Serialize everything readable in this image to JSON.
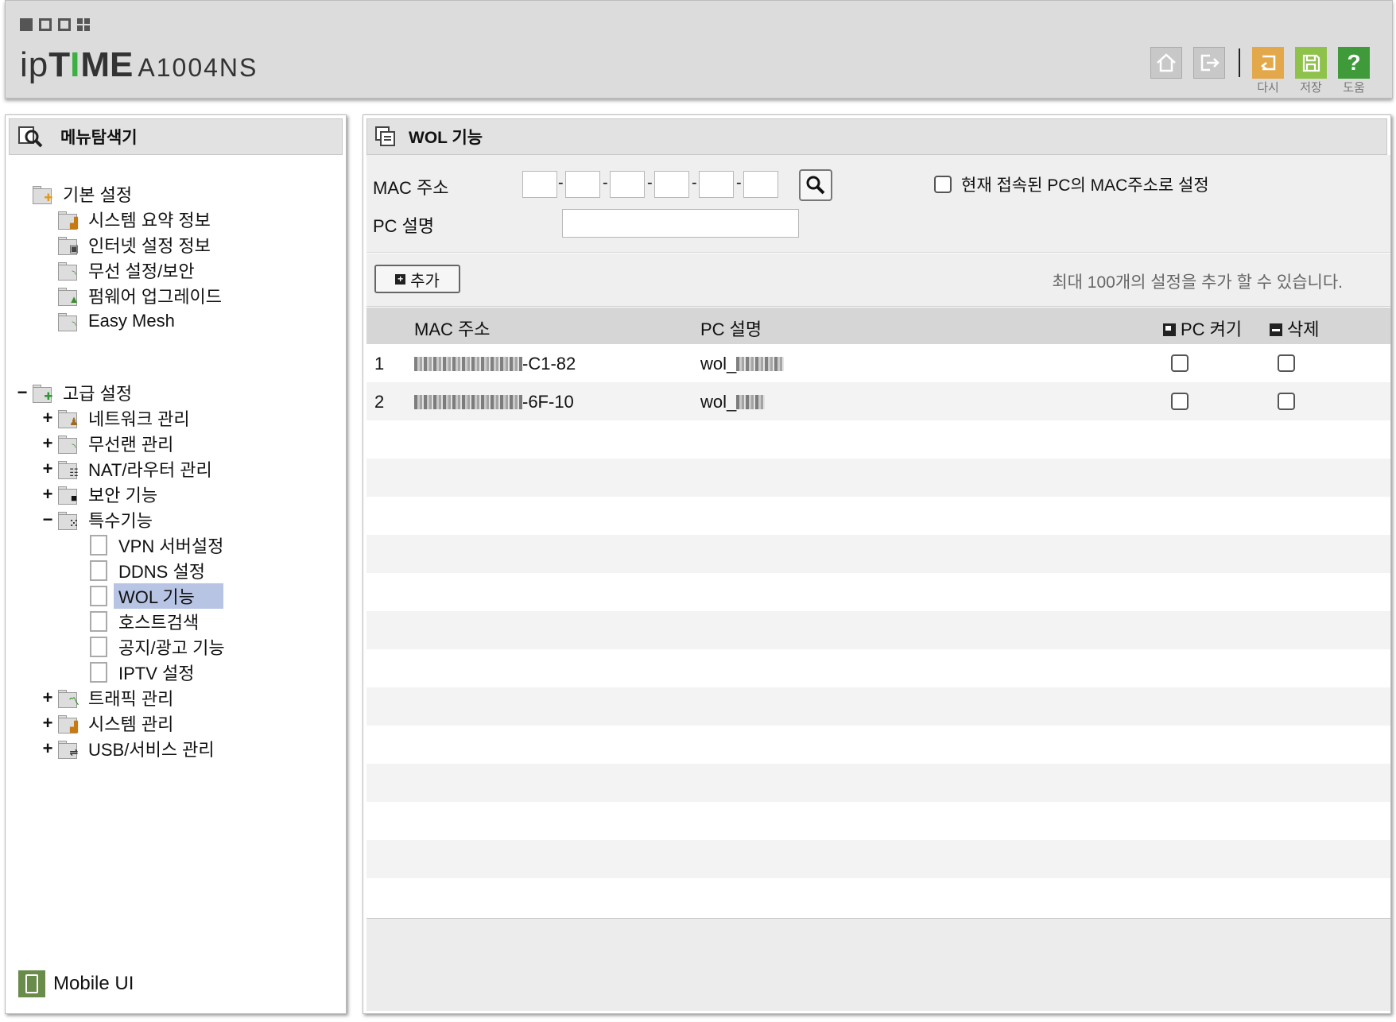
{
  "header": {
    "logo_prefix": "ip",
    "logo_bold": "T",
    "logo_i": "I",
    "logo_rest": "ME",
    "model": "A1004NS",
    "buttons": [
      {
        "name": "home-icon"
      },
      {
        "name": "logout-icon"
      },
      {
        "name": "undo-icon",
        "label": "다시"
      },
      {
        "name": "save-icon",
        "label": "저장"
      },
      {
        "name": "help-icon",
        "label": "도움"
      }
    ],
    "help_glyph": "?"
  },
  "left": {
    "title": "메뉴탐색기",
    "basic": {
      "label": "기본 설정",
      "items": [
        "시스템 요약 정보",
        "인터넷 설정 정보",
        "무선 설정/보안",
        "펌웨어 업그레이드",
        "Easy Mesh"
      ]
    },
    "advanced": {
      "toggle": "−",
      "label": "고급 설정",
      "items": [
        {
          "toggle": "+",
          "label": "네트워크 관리"
        },
        {
          "toggle": "+",
          "label": "무선랜 관리"
        },
        {
          "toggle": "+",
          "label": "NAT/라우터 관리"
        },
        {
          "toggle": "+",
          "label": "보안 기능"
        },
        {
          "toggle": "−",
          "label": "특수기능"
        }
      ],
      "special_items": [
        "VPN 서버설정",
        "DDNS 설정",
        "WOL 기능",
        "호스트검색",
        "공지/광고 기능",
        "IPTV 설정"
      ],
      "more_items": [
        {
          "toggle": "+",
          "label": "트래픽 관리"
        },
        {
          "toggle": "+",
          "label": "시스템 관리"
        },
        {
          "toggle": "+",
          "label": "USB/서비스 관리"
        }
      ]
    },
    "mobile": "Mobile UI"
  },
  "main": {
    "title": "WOL 기능",
    "mac_label": "MAC 주소",
    "pc_desc_label": "PC 설명",
    "current_pc_label": "현재 접속된 PC의 MAC주소로 설정",
    "add_button": "추가",
    "add_note": "최대 100개의 설정을 추가 할 수 있습니다.",
    "columns": {
      "mac": "MAC 주소",
      "desc": "PC 설명",
      "power": "PC 켜기",
      "delete": "삭제"
    },
    "rows": [
      {
        "no": "1",
        "mac_suffix": "-C1-82",
        "desc_prefix": "wol_"
      },
      {
        "no": "2",
        "mac_suffix": "-6F-10",
        "desc_prefix": "wol_"
      }
    ]
  }
}
